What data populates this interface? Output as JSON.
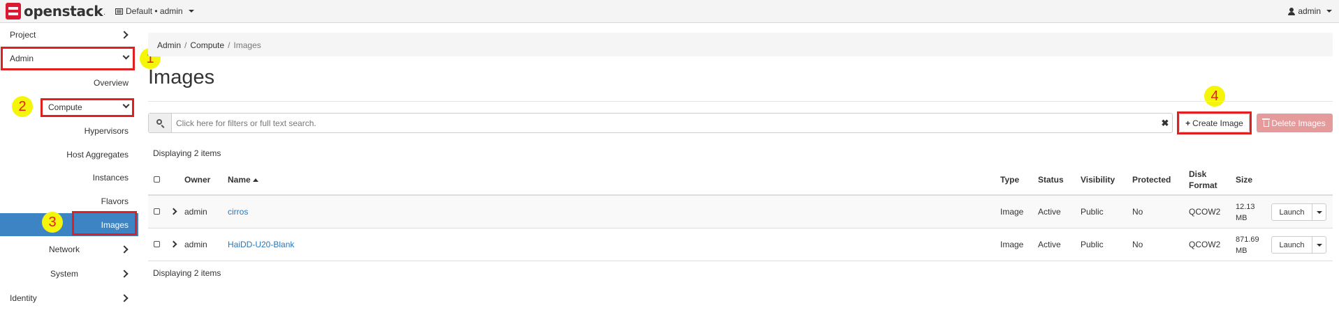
{
  "topbar": {
    "brand": "openstack",
    "brand_suffix": ".",
    "context": "Default • admin",
    "user": "admin"
  },
  "sidebar": {
    "project": "Project",
    "admin": "Admin",
    "overview": "Overview",
    "compute": "Compute",
    "hypervisors": "Hypervisors",
    "host_aggregates": "Host Aggregates",
    "instances": "Instances",
    "flavors": "Flavors",
    "images": "Images",
    "network": "Network",
    "system": "System",
    "identity": "Identity"
  },
  "annotations": [
    "1",
    "2",
    "3",
    "4"
  ],
  "breadcrumb": {
    "admin": "Admin",
    "compute": "Compute",
    "current": "Images"
  },
  "page_title": "Images",
  "search": {
    "placeholder": "Click here for filters or full text search."
  },
  "actions": {
    "create": "Create Image",
    "delete": "Delete Images"
  },
  "display_count": "Displaying 2 items",
  "table": {
    "headers": {
      "owner": "Owner",
      "name": "Name",
      "type": "Type",
      "status": "Status",
      "visibility": "Visibility",
      "protected": "Protected",
      "disk_format_1": "Disk",
      "disk_format_2": "Format",
      "size": "Size"
    },
    "rows": [
      {
        "owner": "admin",
        "name": "cirros",
        "type": "Image",
        "status": "Active",
        "visibility": "Public",
        "protected": "No",
        "disk_format": "QCOW2",
        "size_1": "12.13",
        "size_2": "MB",
        "action": "Launch"
      },
      {
        "owner": "admin",
        "name": "HaiDD-U20-Blank",
        "type": "Image",
        "status": "Active",
        "visibility": "Public",
        "protected": "No",
        "disk_format": "QCOW2",
        "size_1": "871.69",
        "size_2": "MB",
        "action": "Launch"
      }
    ]
  },
  "colors": {
    "accent": "#3d84c4",
    "annotation_red": "#e02020",
    "annotation_yellow": "#f5f50a",
    "link": "#2a76b7",
    "delete_btn": "#e59b9b"
  }
}
